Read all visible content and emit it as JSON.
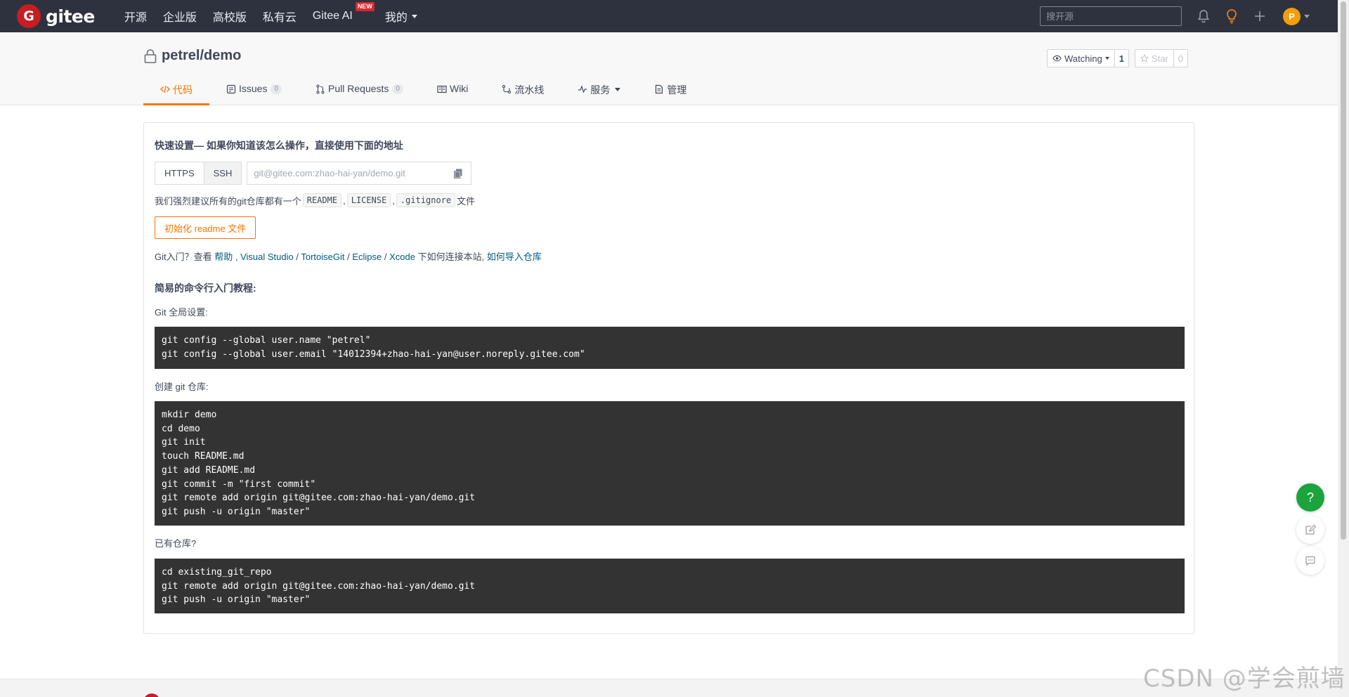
{
  "navbar": {
    "logo_letter": "G",
    "logo_text": "gitee",
    "links": [
      "开源",
      "企业版",
      "高校版",
      "私有云"
    ],
    "ai_link": "Gitee AI",
    "ai_badge": "NEW",
    "mine_link": "我的",
    "search_placeholder": "搜开源",
    "avatar_letter": "P"
  },
  "project": {
    "title": "petrel/demo",
    "watching_label": "Watching",
    "watching_count": "1",
    "star_label": "Star",
    "star_count": "0"
  },
  "tabs": {
    "code": "代码",
    "issues": "Issues",
    "issues_count": "0",
    "pulls": "Pull Requests",
    "pulls_count": "0",
    "wiki": "Wiki",
    "pipeline": "流水线",
    "service": "服务",
    "manage": "管理"
  },
  "quick_setup": {
    "heading": "快速设置— 如果你知道该怎么操作，直接使用下面的地址",
    "https_label": "HTTPS",
    "ssh_label": "SSH",
    "url_value": "git@gitee.com:zhao-hai-yan/demo.git",
    "recommend_prefix": "我们强烈建议所有的git仓库都有一个",
    "readme": "README",
    "license": "LICENSE",
    "gitignore": ".gitignore",
    "sep": ",",
    "recommend_suffix": "文件",
    "init_button": "初始化 readme 文件"
  },
  "intro": {
    "prefix": "Git入门？查看 ",
    "help": "帮助",
    "comma": " , ",
    "vs": "Visual Studio",
    "slash": " / ",
    "tortoise": "TortoiseGit",
    "eclipse": "Eclipse",
    "xcode": "Xcode",
    "middle": " 下如何连接本站, ",
    "import": "如何导入仓库"
  },
  "tutorial": {
    "heading": "简易的命令行入门教程:",
    "global_label": "Git 全局设置:",
    "global_code": "git config --global user.name \"petrel\"\ngit config --global user.email \"14012394+zhao-hai-yan@user.noreply.gitee.com\"",
    "create_label": "创建 git 仓库:",
    "create_code": "mkdir demo\ncd demo\ngit init\ntouch README.md\ngit add README.md\ngit commit -m \"first commit\"\ngit remote add origin git@gitee.com:zhao-hai-yan/demo.git\ngit push -u origin \"master\"",
    "existing_label": "已有仓库?",
    "existing_code": "cd existing_git_repo\ngit remote add origin git@gitee.com:zhao-hai-yan/demo.git\ngit push -u origin \"master\""
  },
  "float": {
    "help": "?"
  },
  "watermark": "CSDN @学会煎墙",
  "colors": {
    "navbar_bg": "#2e323f",
    "accent": "#fe7300",
    "brand_red": "#c71d23",
    "link": "#005980",
    "code_bg": "#333333",
    "help_green": "#1ba43b"
  }
}
